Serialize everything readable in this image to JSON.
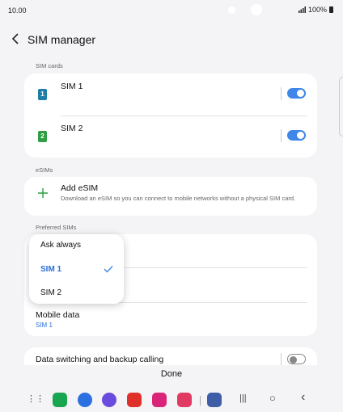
{
  "status": {
    "time": "10.00",
    "battery": "100%"
  },
  "header": {
    "title": "SIM manager"
  },
  "sections": {
    "sim_cards": "SIM cards",
    "esims": "eSIMs",
    "preferred": "Preferred SIMs"
  },
  "sims": [
    {
      "label": "SIM 1",
      "badge": "1",
      "color": "#1f7ea6",
      "enabled": true
    },
    {
      "label": "SIM 2",
      "badge": "2",
      "color": "#2f9e44",
      "enabled": true
    }
  ],
  "esim": {
    "title": "Add eSIM",
    "description": "Download an eSIM so you can connect to mobile networks without a physical SIM card."
  },
  "preferred": {
    "mobile_data_title": "Mobile data",
    "mobile_data_value": "SIM 1",
    "data_switching_title": "Data switching and backup calling",
    "data_switching_enabled": false
  },
  "dropdown": {
    "options": [
      "Ask always",
      "SIM 1",
      "SIM 2"
    ],
    "selected": "SIM 1"
  },
  "footer": {
    "done": "Done"
  },
  "nav": {
    "apps": [
      {
        "name": "phone",
        "color": "#1aa550"
      },
      {
        "name": "messages",
        "color": "#2c6fe0"
      },
      {
        "name": "internet",
        "color": "#6a4be0"
      },
      {
        "name": "flipboard",
        "color": "#e0302a"
      },
      {
        "name": "gallery",
        "color": "#d9247a"
      },
      {
        "name": "camera",
        "color": "#e03a62"
      },
      {
        "name": "settings",
        "color": "#3f5ea8"
      }
    ],
    "apps_glyph": "⋮⋮",
    "recents_glyph": "|||",
    "home_glyph": "○",
    "back_glyph": "‹"
  },
  "colors": {
    "accent": "#3e86e8",
    "link": "#2a6fd6",
    "background": "#f4f4f6"
  }
}
